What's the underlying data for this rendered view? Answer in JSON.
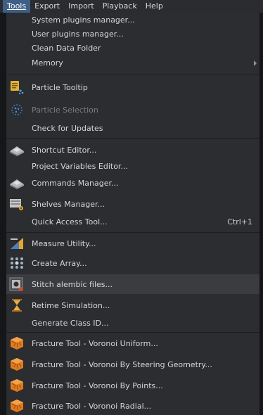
{
  "menubar": [
    {
      "label": "Tools",
      "active": true
    },
    {
      "label": "Export"
    },
    {
      "label": "Import"
    },
    {
      "label": "Playback"
    },
    {
      "label": "Help"
    }
  ],
  "items": [
    {
      "label": "System plugins manager...",
      "icon": ""
    },
    {
      "label": "User plugins manager...",
      "icon": ""
    },
    {
      "label": "Clean Data Folder",
      "icon": ""
    },
    {
      "label": "Memory",
      "icon": "",
      "submenu": true
    },
    {
      "label": "Particle Tooltip",
      "icon": "particle-tooltip-icon"
    },
    {
      "label": "Particle Selection",
      "icon": "particle-selection-icon",
      "disabled": true
    },
    {
      "label": "Check for Updates",
      "icon": ""
    },
    {
      "label": "Shortcut Editor...",
      "icon": "shortcut-editor-icon"
    },
    {
      "label": "Project Variables Editor...",
      "icon": ""
    },
    {
      "label": "Commands Manager...",
      "icon": "commands-manager-icon"
    },
    {
      "label": "Shelves Manager...",
      "icon": "shelves-manager-icon"
    },
    {
      "label": "Quick Access Tool...",
      "icon": "",
      "shortcut": "Ctrl+1"
    },
    {
      "label": "Measure Utility...",
      "icon": "measure-utility-icon"
    },
    {
      "label": "Create Array...",
      "icon": "create-array-icon"
    },
    {
      "label": "Stitch alembic files...",
      "icon": "stitch-alembic-icon",
      "hover": true
    },
    {
      "label": "Retime Simulation...",
      "icon": "retime-simulation-icon"
    },
    {
      "label": "Generate Class ID...",
      "icon": ""
    },
    {
      "label": "Fracture Tool - Voronoi Uniform...",
      "icon": "fracture-icon"
    },
    {
      "label": "Fracture Tool - Voronoi By Steering Geometry...",
      "icon": "fracture-icon"
    },
    {
      "label": "Fracture Tool - Voronoi By Points...",
      "icon": "fracture-icon"
    },
    {
      "label": "Fracture Tool - Voronoi Radial...",
      "icon": "fracture-icon"
    }
  ]
}
